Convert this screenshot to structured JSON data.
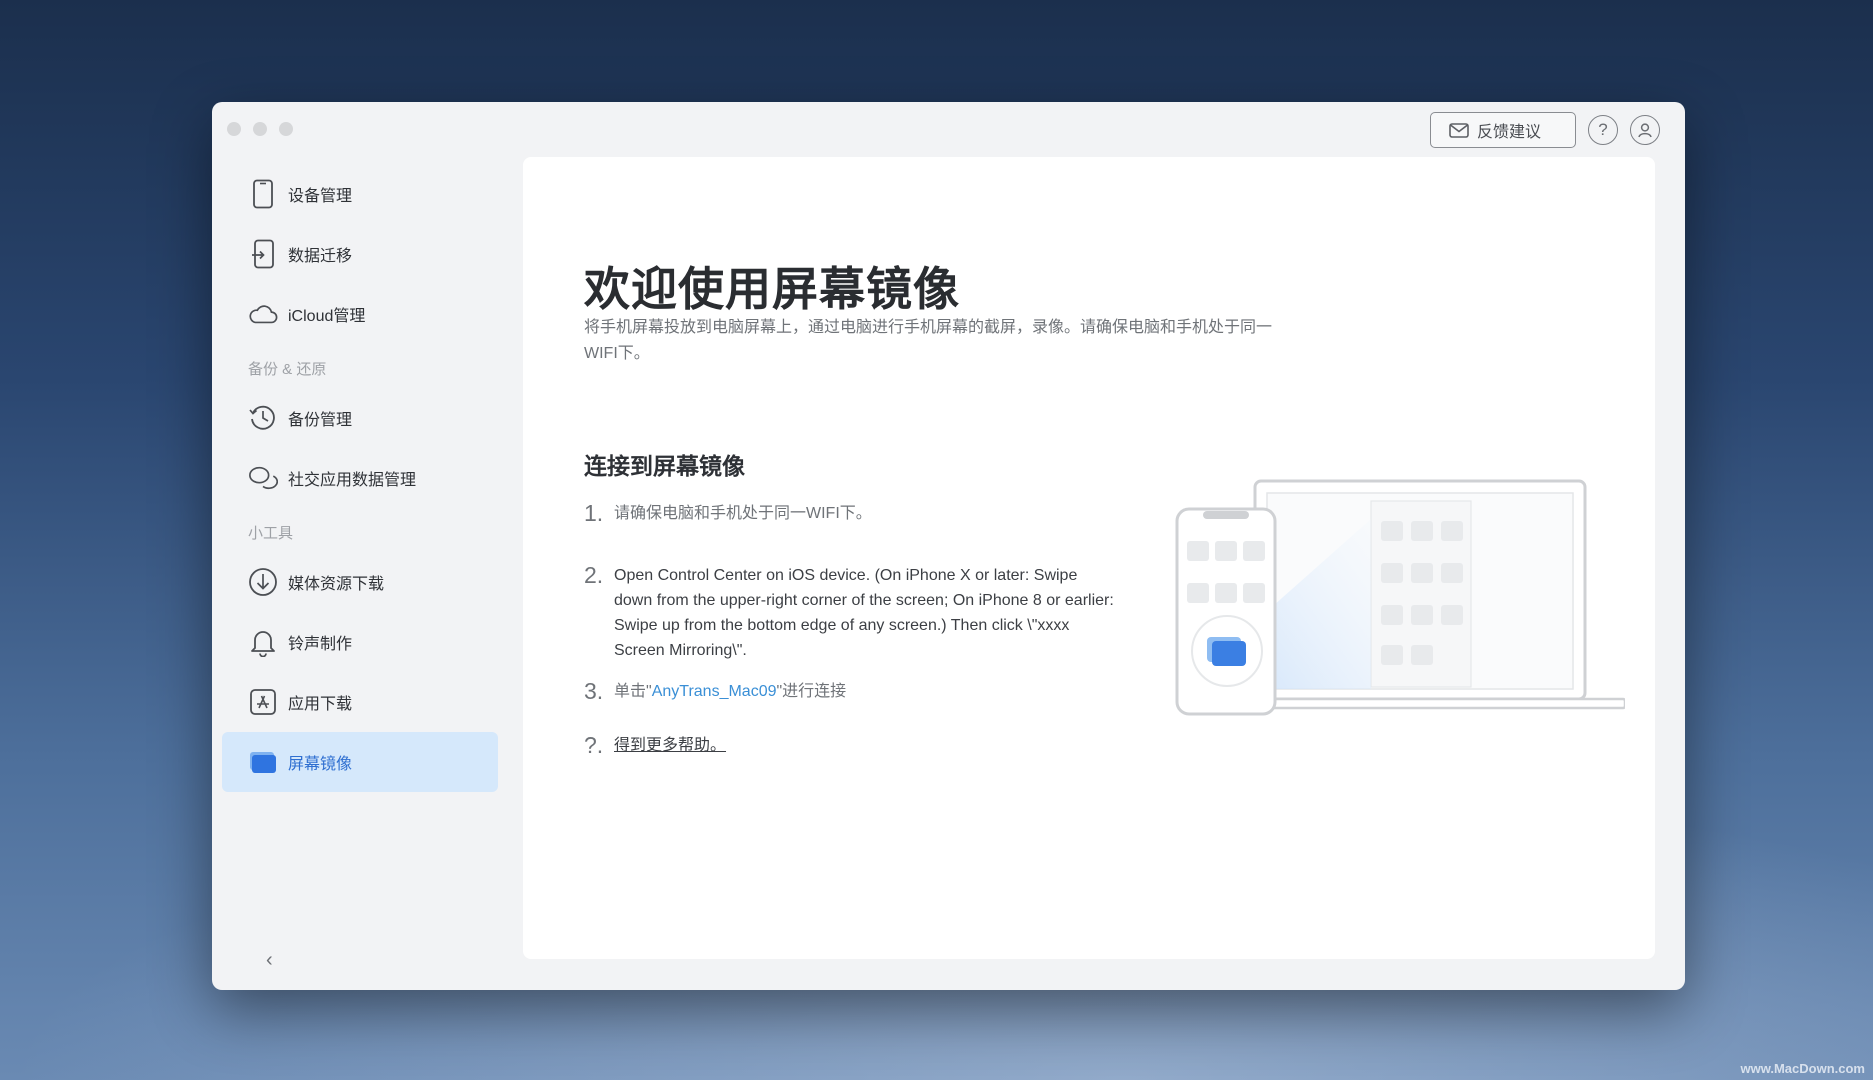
{
  "window": {
    "feedback_label": "反馈建议",
    "help_icon": "question-circle-icon",
    "account_icon": "user-circle-icon"
  },
  "sidebar": {
    "items": [
      {
        "label": "设备管理",
        "icon": "phone-icon"
      },
      {
        "label": "数据迁移",
        "icon": "transfer-icon"
      },
      {
        "label": "iCloud管理",
        "icon": "cloud-icon"
      },
      {
        "label": "备份管理",
        "icon": "history-icon"
      },
      {
        "label": "社交应用数据管理",
        "icon": "chat-icon"
      },
      {
        "label": "媒体资源下载",
        "icon": "download-icon"
      },
      {
        "label": "铃声制作",
        "icon": "bell-icon"
      },
      {
        "label": "应用下载",
        "icon": "app-store-icon"
      },
      {
        "label": "屏幕镜像",
        "icon": "screen-mirror-icon"
      }
    ],
    "sections": [
      "备份 & 还原",
      "小工具"
    ],
    "active_item": "屏幕镜像"
  },
  "content": {
    "title": "欢迎使用屏幕镜像",
    "subtitle": "将手机屏幕投放到电脑屏幕上，通过电脑进行手机屏幕的截屏，录像。请确保电脑和手机处于同一WIFI下。",
    "section_title": "连接到屏幕镜像",
    "steps": [
      {
        "num": "1.",
        "text": "请确保电脑和手机处于同一WIFI下。"
      },
      {
        "num": "2.",
        "text": "Open Control Center on iOS device. (On iPhone X or later: Swipe down from the upper-right corner of the screen; On iPhone 8 or earlier: Swipe up from the bottom edge of any screen.) Then click \\\"xxxx Screen Mirroring\\\"."
      },
      {
        "num": "3.",
        "prefix": "单击\"",
        "device": "AnyTrans_Mac09",
        "suffix": "\"进行连接"
      }
    ],
    "help": {
      "num": "?.",
      "text": "得到更多帮助。"
    }
  },
  "watermark": "www.MacDown.com",
  "colors": {
    "accent": "#2f6fd1",
    "active_bg": "#d5e8fb",
    "link": "#3a8fd6"
  }
}
